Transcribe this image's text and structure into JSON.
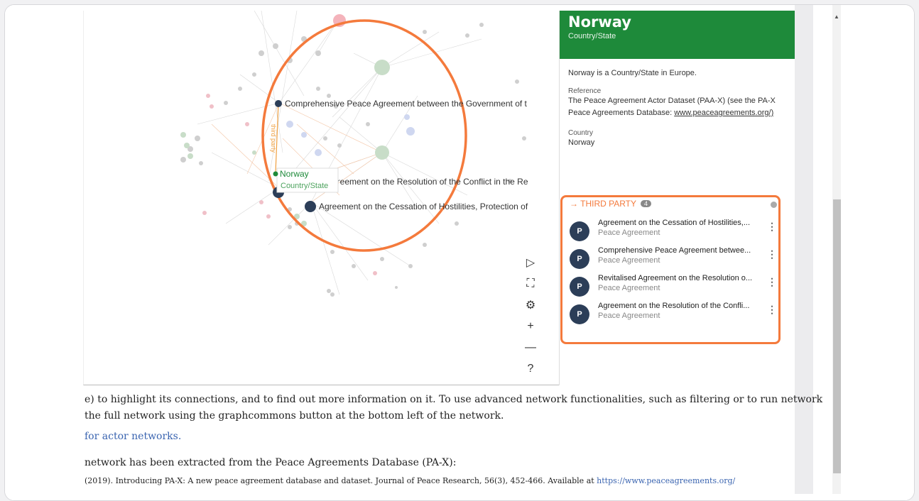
{
  "panel": {
    "title": "Norway",
    "subtitle": "Country/State",
    "description": "Norway is a Country/State in Europe.",
    "reference_label": "Reference",
    "reference_text": "The Peace Agreement Actor Dataset (PAA-X) (see the PA-X Peace Agreements Database:",
    "reference_link": "www.peaceagreements.org/)",
    "country_label": "Country",
    "country_value": "Norway"
  },
  "third_party": {
    "label": "→ THIRD PARTY",
    "count": "4",
    "items": [
      {
        "avatar": "P",
        "name": "Agreement on the Cessation of Hostilities,...",
        "type": "Peace Agreement"
      },
      {
        "avatar": "P",
        "name": "Comprehensive Peace Agreement betwee...",
        "type": "Peace Agreement"
      },
      {
        "avatar": "P",
        "name": "Revitalised Agreement on the Resolution o...",
        "type": "Peace Agreement"
      },
      {
        "avatar": "P",
        "name": "Agreement on the Resolution of the Confli...",
        "type": "Peace Agreement"
      }
    ]
  },
  "graph": {
    "node_labels": {
      "cpa": "Comprehensive Peace Agreement between the Government of t",
      "resolution": "greement on the Resolution of the Conflict in the Re",
      "cessation": "Agreement on the Cessation of Hostilities, Protection of",
      "norway": "Norway",
      "norway_type": "Country/State",
      "edge": "third party"
    }
  },
  "tools": {
    "play": "▷",
    "expand": "⛶",
    "settings": "⚙",
    "zoom_in": "+",
    "zoom_out": "—",
    "help": "?"
  },
  "text": {
    "line1": "e) to highlight its connections, and to find out more information on it. To use advanced network functionalities, such as filtering or to run network",
    "line2": "the full network using the graphcommons button at the bottom left of the network.",
    "line3": "for actor networks.",
    "line4": "network has been extracted from the Peace Agreements Database (PA-X):",
    "line5": "(2019). Introducing PA-X: A new peace agreement database and dataset. Journal of Peace Research, 56(3), 452-466. Available at",
    "line5_link": "https://www.peaceagreements.org/"
  },
  "colors": {
    "panel_header": "#1e8a3a",
    "highlight": "#f47a3c",
    "node_dark": "#2c3e58"
  }
}
